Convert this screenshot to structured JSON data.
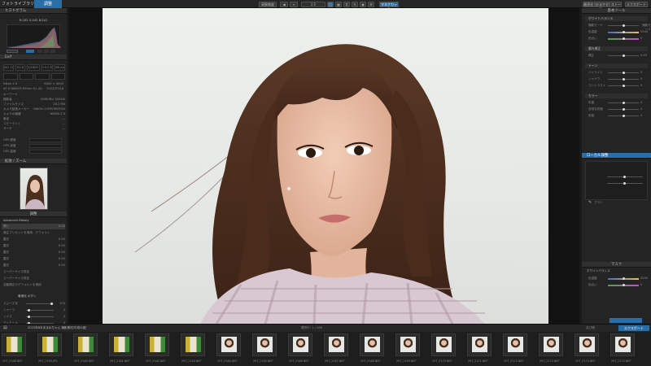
{
  "topbar": {
    "library_tab": "フォトライブラリ",
    "custom_tab": "調整",
    "rating_label": "高解像度",
    "export_label": "最適化 (おまかせ) ストーリー",
    "export2_label": "マスクカット",
    "right_btn": "エクスポート"
  },
  "left": {
    "histogram_title": "ヒストグラム",
    "rgb_label": "R:242 G:242 B:242",
    "exif_title": "Exif",
    "exif_values": [
      "ISO 100",
      "f/2.8",
      "1/1600 s",
      "+0.0 EV",
      "85 mm"
    ],
    "camera": "Nikon Z 6",
    "camera_size": "6000 × 4000",
    "lens": "AF-S NIKKOR 85mm f/1.4G",
    "lens_date": "2022/07/18",
    "info_rows": [
      {
        "label": "キーワード",
        "value": ""
      },
      {
        "label": "撮影者",
        "value": "SHINOBU YAZAKI"
      },
      {
        "label": "ファイルサイズ",
        "value": "28.2 MB"
      },
      {
        "label": "カメラ製造メーカー",
        "value": "NIKON CORPORATION"
      },
      {
        "label": "カメラの機種",
        "value": "NIKON Z 6"
      },
      {
        "label": "著者",
        "value": "—"
      },
      {
        "label": "コピーライト",
        "value": "—"
      },
      {
        "label": "サーチ",
        "value": "—"
      }
    ],
    "gps_rows": [
      "GPS 緯度",
      "GPS 経度",
      "GPS 高度"
    ],
    "navigator_title": "拡張 / ズーム",
    "presets_title": "調整",
    "presets_sub": "Advanced History",
    "history_rows": [
      {
        "label": "開く",
        "value": "0.00"
      },
      {
        "label": "補正プリセットを適用 : デフォルト",
        "value": ""
      },
      {
        "label": "露光",
        "value": "0.45"
      },
      {
        "label": "露光",
        "value": "0.45"
      },
      {
        "label": "露光",
        "value": "0.45"
      },
      {
        "label": "露光",
        "value": "0.45"
      },
      {
        "label": "露光",
        "value": "0.45"
      },
      {
        "label": "スーパーサイズ設定",
        "value": ""
      },
      {
        "label": "スーパーサイズ設定",
        "value": ""
      },
      {
        "label": "自動補正のデフォルトを適用",
        "value": ""
      }
    ],
    "bottom_title": "最適化 ボタン",
    "bottom_rows": [
      {
        "label": "スムーズ化",
        "value": "100"
      },
      {
        "label": "シャープ",
        "value": "0"
      },
      {
        "label": "ノイズ",
        "value": "0"
      },
      {
        "label": "ディテール",
        "value": "0"
      }
    ]
  },
  "right": {
    "top_title": "基本ツール",
    "groups": [
      {
        "title": "ホワイトバランス",
        "rows": [
          {
            "label": "撮影モード",
            "value": "撮影モード"
          },
          {
            "label": "色温度",
            "value": "5000"
          },
          {
            "label": "色合い",
            "value": "0"
          }
        ]
      },
      {
        "title": "露光補正",
        "rows": [
          {
            "label": "補正",
            "value": "0.45"
          }
        ]
      },
      {
        "title": "トーン",
        "rows": [
          {
            "label": "ハイライト",
            "value": "0"
          },
          {
            "label": "シャドウ",
            "value": "0"
          },
          {
            "label": "コントラスト",
            "value": "0"
          }
        ]
      },
      {
        "title": "カラー",
        "rows": [
          {
            "label": "彩度",
            "value": "0"
          },
          {
            "label": "自然な彩度",
            "value": "0"
          },
          {
            "label": "色相",
            "value": "0"
          }
        ]
      }
    ],
    "local_title": "ローカル調整",
    "local_row": "ブラシ",
    "mask_title": "マスク",
    "wb_title": "ホワイトバランス",
    "wb_rows": [
      {
        "label": "色温度",
        "value": "5000"
      },
      {
        "label": "色合い",
        "value": "0"
      }
    ]
  },
  "filmbar": {
    "path": "2022年8月あまねちゃん 撮影素材/平成の夏/",
    "count": "選択中: 1 / 168",
    "sort_label": "並び順",
    "export_btn": "エクスポート"
  },
  "thumbs": [
    {
      "name": "297_2188.NEF",
      "type": "yellow"
    },
    {
      "name": "297_2159.JPG",
      "type": "yellow"
    },
    {
      "name": "297_2160.NEF",
      "type": "yellow"
    },
    {
      "name": "297_2161.NEF",
      "type": "yellow"
    },
    {
      "name": "297_2162.NEF",
      "type": "yellow"
    },
    {
      "name": "297_2163.NEF",
      "type": "yellow"
    },
    {
      "name": "297_2164.NEF",
      "type": "portrait"
    },
    {
      "name": "297_2165.NEF",
      "type": "portrait"
    },
    {
      "name": "297_2166.NEF",
      "type": "portrait"
    },
    {
      "name": "297_2167.NEF",
      "type": "portrait"
    },
    {
      "name": "297_2168.NEF",
      "type": "portrait"
    },
    {
      "name": "297_2169.NEF",
      "type": "portrait"
    },
    {
      "name": "297_2170.NEF",
      "type": "portrait"
    },
    {
      "name": "297_2171.NEF",
      "type": "portrait"
    },
    {
      "name": "297_2172.NEF",
      "type": "portrait"
    },
    {
      "name": "297_2173.NEF",
      "type": "portrait"
    },
    {
      "name": "297_2174.NEF",
      "type": "portrait"
    },
    {
      "name": "297_2175.NEF",
      "type": "portrait"
    }
  ],
  "colors": {
    "accent": "#2a6ea8",
    "panel": "#242424",
    "viewer": "#121212"
  },
  "icons": [
    "back-icon",
    "grid-icon",
    "compare-icon",
    "zoom-icon",
    "crop-icon",
    "brush-icon",
    "settings-icon",
    "eye-icon"
  ]
}
